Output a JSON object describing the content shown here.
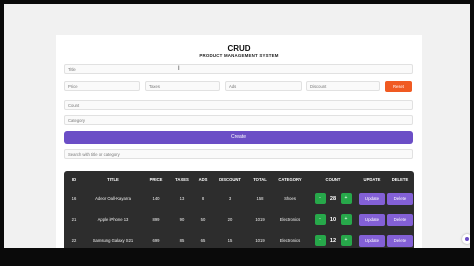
{
  "header": {
    "title": "CRUD",
    "subtitle": "PRODUCT MANAGEMENT SYSTEM"
  },
  "form": {
    "title_placeholder": "Title",
    "price_placeholder": "Price",
    "taxes_placeholder": "Taxes",
    "ads_placeholder": "Ads",
    "discount_placeholder": "Discount",
    "reset_label": "Reset",
    "count_placeholder": "Count",
    "category_placeholder": "Category",
    "create_label": "Create",
    "search_placeholder": "Search with title or category"
  },
  "table": {
    "headers": [
      "ID",
      "TITLE",
      "PRICE",
      "TAXES",
      "ADS",
      "DISCOUNT",
      "TOTAL",
      "CATEGORY",
      "COUNT",
      "UPDATE",
      "DELETE"
    ],
    "rows": [
      {
        "id": "16",
        "title": "Adeor Oall-Kayarra",
        "price": "140",
        "taxes": "13",
        "ads": "8",
        "discount": "3",
        "total": "158",
        "category": "Shoes",
        "count": "28"
      },
      {
        "id": "21",
        "title": "Apple iPhone 13",
        "price": "899",
        "taxes": "90",
        "ads": "50",
        "discount": "20",
        "total": "1019",
        "category": "Electronics",
        "count": "10"
      },
      {
        "id": "22",
        "title": "Samsung Galaxy S21",
        "price": "699",
        "taxes": "85",
        "ads": "65",
        "discount": "15",
        "total": "1019",
        "category": "Electronics",
        "count": "12"
      }
    ],
    "minus_label": "-",
    "plus_label": "+",
    "update_label": "Update",
    "delete_label": "Delete"
  },
  "colors": {
    "accent": "#6b4ec6",
    "reset": "#f05a22",
    "count_btn": "#27a84a",
    "table_bg": "#2d2d2d"
  }
}
